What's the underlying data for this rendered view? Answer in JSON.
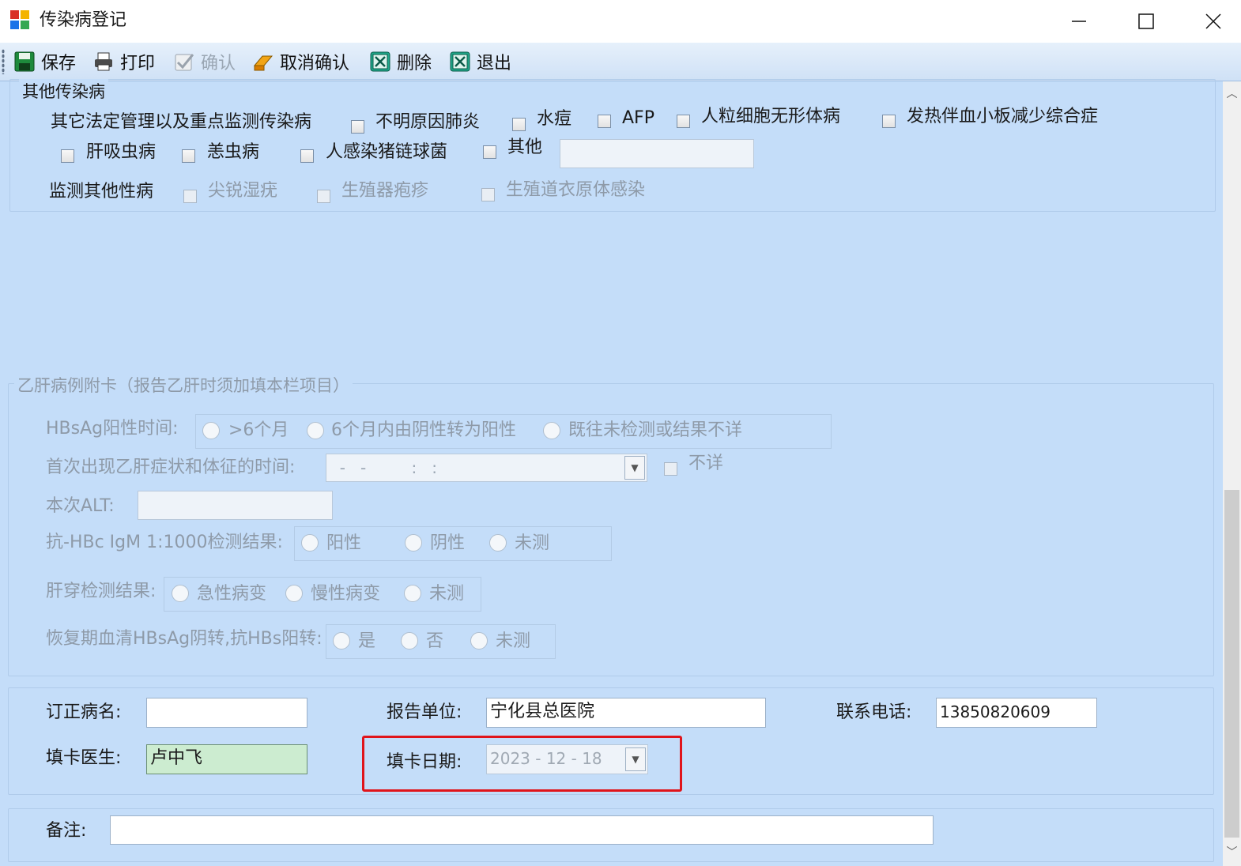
{
  "window": {
    "title": "传染病登记",
    "controls": [
      "minimize",
      "maximize",
      "close"
    ]
  },
  "toolbar": {
    "buttons": [
      {
        "label": "保存",
        "icon": "save-icon",
        "enabled": true
      },
      {
        "label": "打印",
        "icon": "print-icon",
        "enabled": true
      },
      {
        "label": "确认",
        "icon": "confirm-icon",
        "enabled": false
      },
      {
        "label": "取消确认",
        "icon": "eraser-icon",
        "enabled": true
      },
      {
        "label": "删除",
        "icon": "delete-icon",
        "enabled": true
      },
      {
        "label": "退出",
        "icon": "exit-icon",
        "enabled": true
      }
    ]
  },
  "other_diseases": {
    "legend": "其他传染病",
    "row1_label": "其它法定管理以及重点监测传染病",
    "checkboxes": [
      "不明原因肺炎",
      "水痘",
      "AFP",
      "人粒细胞无形体病",
      "发热伴血小板减少综合症",
      "肝吸虫病",
      "恙虫病",
      "人感染猪链球菌",
      "其他"
    ],
    "other_value": "",
    "std_label": "监测其他性病",
    "std_checkboxes": [
      "尖锐湿疣",
      "生殖器疱疹",
      "生殖道衣原体感染"
    ]
  },
  "hepb": {
    "legend": "乙肝病例附卡（报告乙肝时须加填本栏项目）",
    "hbsag_label": "HBsAg阳性时间:",
    "hbsag_options": [
      ">6个月",
      "6个月内由阴性转为阳性",
      "既往未检测或结果不详"
    ],
    "onset_label": "首次出现乙肝症状和体征的时间:",
    "onset_value": "  -   -         :   :",
    "onset_unknown": "不详",
    "alt_label": "本次ALT:",
    "alt_value": "",
    "igm_label": "抗-HBc IgM 1:1000检测结果:",
    "igm_options": [
      "阳性",
      "阴性",
      "未测"
    ],
    "liver_label": "肝穿检测结果:",
    "liver_options": [
      "急性病变",
      "慢性病变",
      "未测"
    ],
    "recovery_label": "恢复期血清HBsAg阴转,抗HBs阳转:",
    "recovery_options": [
      "是",
      "否",
      "未测"
    ]
  },
  "report": {
    "corrected_label": "订正病名:",
    "corrected_value": "",
    "unit_label": "报告单位:",
    "unit_value": "宁化县总医院",
    "phone_label": "联系电话:",
    "phone_value": "13850820609",
    "doctor_label": "填卡医生:",
    "doctor_value": "卢中飞",
    "date_label": "填卡日期:",
    "date_value": "2023 - 12 - 18"
  },
  "remarks": {
    "label": "备注:",
    "value": ""
  }
}
